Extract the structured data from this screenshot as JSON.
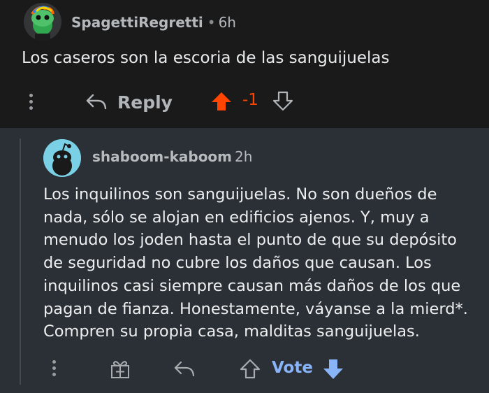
{
  "comment1": {
    "username": "SpagettiRegretti",
    "separator": "•",
    "age": "6h",
    "body": "Los caseros son la escoria de las sanguijuelas",
    "reply_label": "Reply",
    "score": "-1",
    "upvoted": true,
    "colors": {
      "upvote": "#ff4500"
    }
  },
  "comment2": {
    "username": "shaboom-kaboom",
    "age": "2h",
    "body": "Los inquilinos son sanguijuelas. No son dueños de\nnada, sólo se alojan en edificios ajenos. Y, muy a\nmenudo los joden hasta el punto de que su depósito\nde seguridad no cubre los daños que causan. Los\ninquilinos casi siempre causan más daños de los que\npagan de fianza. Honestamente, váyanse a la mierd*.\nCompren su propia casa, malditas sanguijuelas.",
    "vote_label": "Vote",
    "colors": {
      "vote": "#8ab4f8"
    }
  },
  "icons": [
    "more-options-icon",
    "reply-arrow-icon",
    "upvote-arrow-icon",
    "downvote-arrow-icon",
    "award-gift-icon"
  ]
}
